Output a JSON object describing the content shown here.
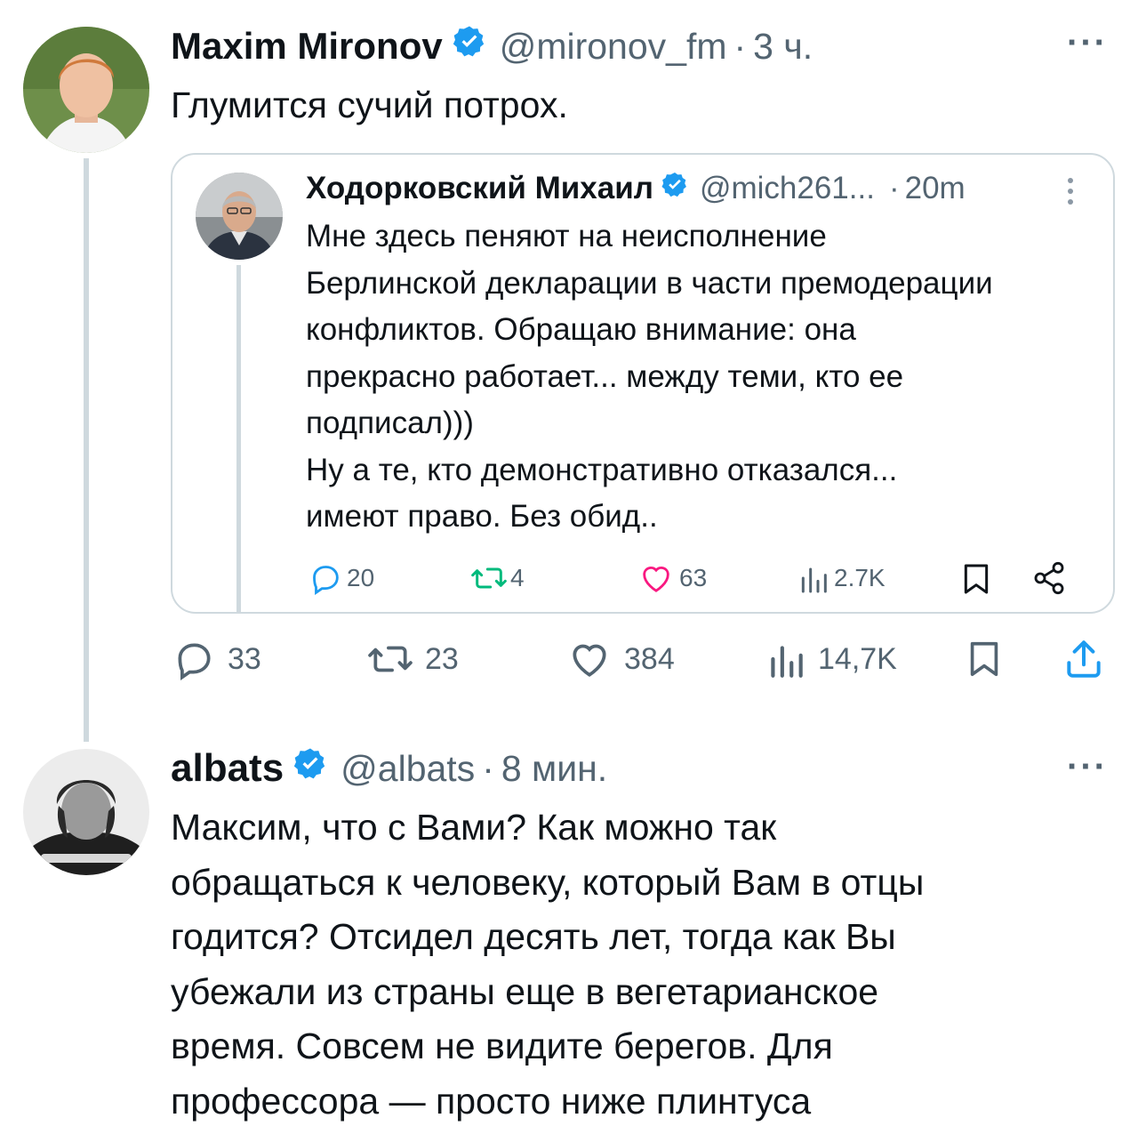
{
  "tweet1": {
    "author_name": "Maxim Mironov",
    "handle": "@mironov_fm",
    "separator": "·",
    "time": "3 ч.",
    "more": "···",
    "text": "Глумится сучий потрох.",
    "quoted": {
      "author_name": "Ходорковский Михаил",
      "handle": "@mich261...",
      "separator": "·",
      "time": "20m",
      "lines": [
        "Мне здесь пеняют на неисполнение",
        "Берлинской декларации в части премодерации",
        "конфликтов. Обращаю внимание: она",
        "прекрасно работает... между теми, кто ее",
        "подписал)))",
        "Ну а те, кто демонстративно отказался...",
        "имеют право. Без обид.."
      ],
      "stats": {
        "replies": "20",
        "retweets": "4",
        "likes": "63",
        "views": "2.7K"
      }
    },
    "stats": {
      "replies": "33",
      "retweets": "23",
      "likes": "384",
      "views": "14,7K"
    }
  },
  "tweet2": {
    "author_name": "albats",
    "handle": "@albats",
    "separator": "·",
    "time": "8 мин.",
    "more": "···",
    "lines": [
      "Максим, что с Вами? Как можно так",
      "обращаться к человеку, который Вам в отцы",
      "годится? Отсидел десять лет, тогда как Вы",
      "убежали из страны еще в вегетарианское",
      "время. Совсем не видите берегов. Для",
      "профессора — просто ниже плинтуса"
    ]
  },
  "colors": {
    "verified": "#1d9bf0",
    "muted": "#536471",
    "line": "#cfd9de",
    "text": "#0f1419"
  },
  "icons": [
    "verified-badge-icon",
    "more-icon",
    "reply-icon",
    "retweet-icon",
    "like-icon",
    "views-icon",
    "bookmark-icon",
    "share-icon"
  ]
}
